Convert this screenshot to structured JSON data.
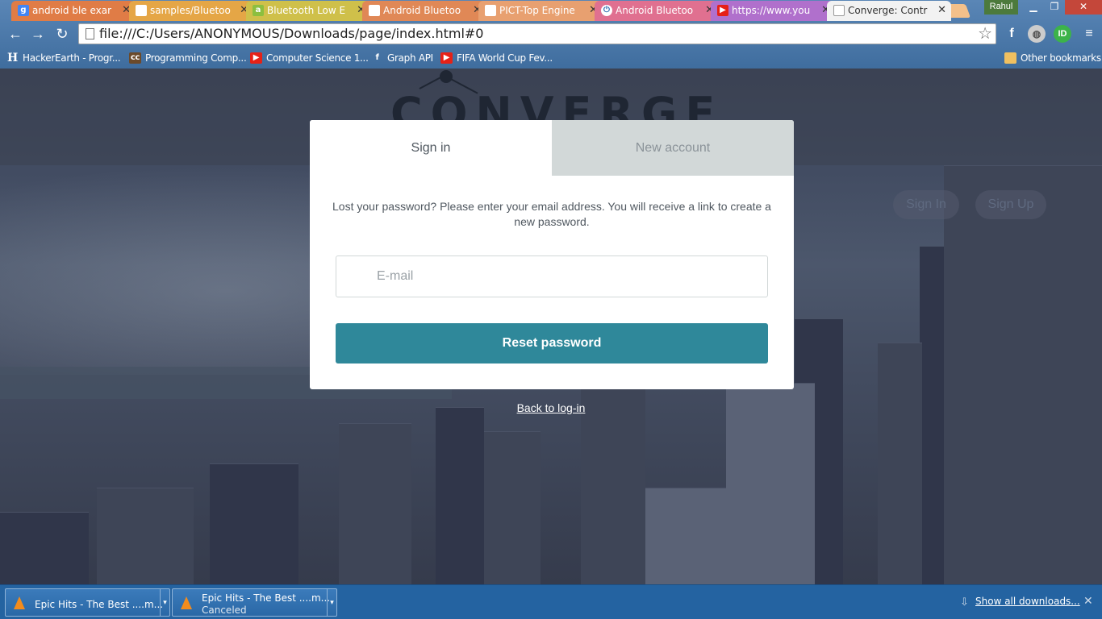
{
  "browser": {
    "tabs": [
      {
        "title": "android ble exar",
        "icon": "google-icon",
        "color": "#e86e3a"
      },
      {
        "title": "samples/Bluetoo",
        "icon": "page-icon",
        "color": "#e8a33a"
      },
      {
        "title": "Bluetooth Low E",
        "icon": "android-icon",
        "color": "#dcc63a"
      },
      {
        "title": "Android Bluetoo",
        "icon": "page-icon",
        "color": "#e07a4a"
      },
      {
        "title": "PICT-Top Engine",
        "icon": "page-icon",
        "color": "#e8a86a"
      },
      {
        "title": "Android Bluetoo",
        "icon": "power-icon",
        "color": "#e46a8c"
      },
      {
        "title": "https://www.you",
        "icon": "youtube-icon",
        "color": "#b06ad0"
      },
      {
        "title": "Converge: Contr",
        "icon": "page-icon",
        "color": "#f2f2f2"
      }
    ],
    "profile_name": "Rahul",
    "address": "file:///C:/Users/ANONYMOUS/Downloads/page/index.html#0",
    "bookmarks": [
      {
        "label": "HackerEarth - Progr...",
        "icon": "hackerearth-icon"
      },
      {
        "label": "Programming Comp...",
        "icon": "codechef-icon"
      },
      {
        "label": "Computer Science 1...",
        "icon": "youtube-icon"
      },
      {
        "label": "Graph API",
        "icon": "facebook-icon"
      },
      {
        "label": "FIFA World Cup Fev...",
        "icon": "youtube-icon"
      }
    ],
    "other_bookmarks": "Other bookmarks"
  },
  "site": {
    "logo_text": "CONVERGE",
    "nav_signin": "Sign In",
    "nav_signup": "Sign Up"
  },
  "modal": {
    "tab_signin": "Sign in",
    "tab_new_account": "New account",
    "message": "Lost your password? Please enter your email address. You will receive a link to create a new password.",
    "email_placeholder": "E-mail",
    "reset_button": "Reset password",
    "accent_color": "#2f889a"
  },
  "back_link": "Back to log-in",
  "downloads": {
    "items": [
      {
        "name": "Epic Hits - The Best ....m...",
        "status": ""
      },
      {
        "name": "Epic Hits - The Best ....m...",
        "status": "Canceled"
      }
    ],
    "show_all": "Show all downloads..."
  }
}
